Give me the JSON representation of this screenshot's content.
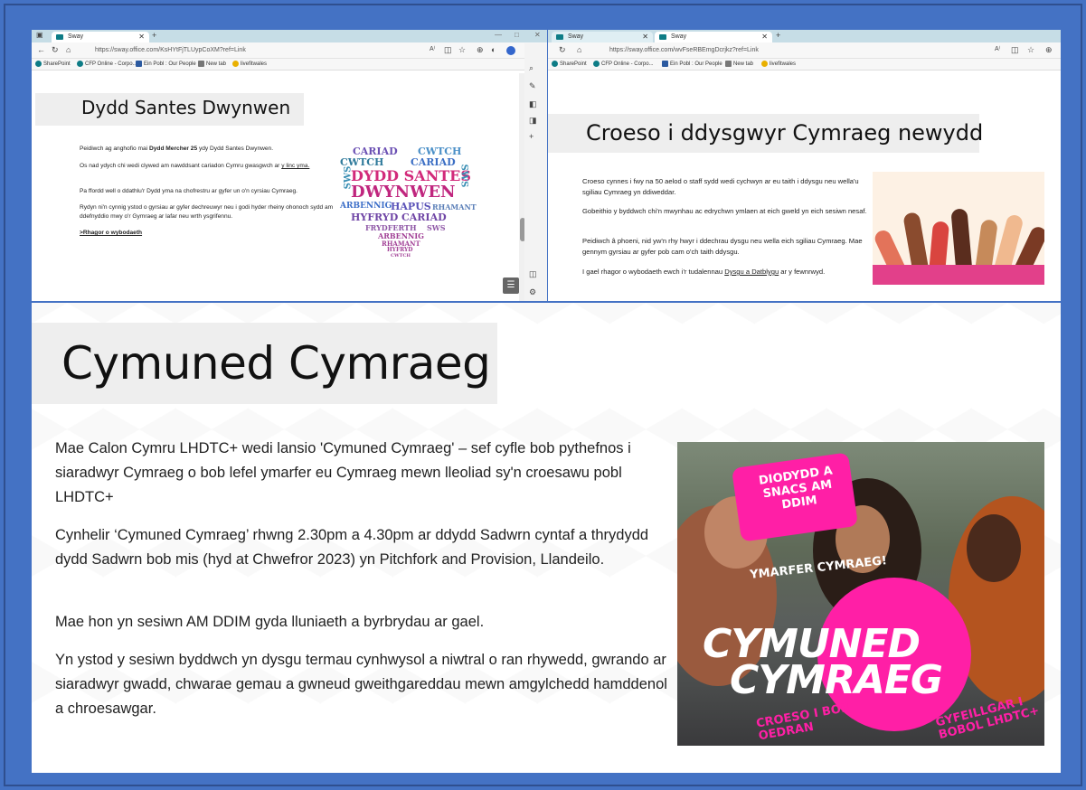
{
  "window1": {
    "tab_label": "Sway",
    "url": "https://sway.office.com/KsHYtFjTLUypCoXM?ref=Link",
    "favorites": [
      "SharePoint",
      "CFP Online - Corpo...",
      "Ein Pobl : Our People",
      "New tab",
      "livefitwales"
    ],
    "title": "Dydd Santes Dwynwen",
    "p1_pre": "Peidiwch ag anghofio mai ",
    "p1_bold": "Dydd Mercher 25",
    "p1_post": " ydy Dydd Santes Dwynwen.",
    "p2_pre": "Os nad ydych chi wedi clywed am nawddsant cariadon Cymru gwasgwch ar ",
    "p2_link": "y linc yma.",
    "p3": "Pa ffordd well o ddathlu'r Dydd yma na chofrestru ar gyfer un o'n cyrsiau Cymraeg.",
    "p4": "Rydyn ni'n cynnig ystod o gyrsiau ar gyfer dechreuwyr neu i godi hyder rheiny ohonoch sydd am ddefnyddio mwy o'r Gymraeg ar lafar neu wrth ysgrifennu.",
    "more_link": ">Rhagor o wybodaeth",
    "word_heart": [
      "CARIAD",
      "CWTCH",
      "CWTCH",
      "CARIAD",
      "SWS",
      "DYDD SANTES",
      "SWS",
      "DWYNWEN",
      "ARBENNIG",
      "HAPUS",
      "RHAMANT",
      "HYFRYD",
      "CARIAD",
      "FRYDFERTH",
      "SWS",
      "ARBENNIG",
      "RHAMANT",
      "HYFRYD",
      "CWTCH"
    ]
  },
  "window2": {
    "tab_label_1": "Sway",
    "tab_label_2": "Sway",
    "url": "https://sway.office.com/wvFseRBEmgDcrjkz?ref=Link",
    "favorites": [
      "SharePoint",
      "CFP Online - Corpo...",
      "Ein Pobl : Our People",
      "New tab",
      "livefitwales"
    ],
    "title": "Croeso i ddysgwyr Cymraeg newydd",
    "p1": "Croeso cynnes i fwy na 50 aelod o staff sydd wedi cychwyn ar eu taith i ddysgu neu wella'u sgiliau Cymraeg yn ddiweddar.",
    "p2": "Gobeithio y byddwch chi'n mwynhau ac edrychwn ymlaen at eich gweld yn eich sesiwn nesaf.",
    "p3": "Peidiwch â phoeni, nid yw'n rhy hwyr i ddechrau dysgu neu wella eich sgiliau Cymraeg. Mae gennym gyrsiau ar gyfer pob cam o'ch taith ddysgu.",
    "p4_pre": "I gael rhagor o wybodaeth ewch i'r tudalennau ",
    "p4_link": "Dysgu a Datblygu",
    "p4_post": " ar y fewnrwyd."
  },
  "main": {
    "title": "Cymuned Cymraeg",
    "p1": "Mae Calon Cymru LHDTC+ wedi lansio 'Cymuned Cymraeg' – sef cyfle bob pythefnos i siaradwyr Cymraeg o bob lefel ymarfer eu Cymraeg mewn lleoliad sy'n croesawu pobl LHDTC+",
    "p2": "Cynhelir ‘Cymuned Cymraeg’ rhwng 2.30pm a 4.30pm ar ddydd Sadwrn cyntaf a thrydydd dydd Sadwrn bob mis (hyd at Chwefror 2023) yn Pitchfork and Provision, Llandeilo.",
    "p3": "Mae hon yn sesiwn AM DDIM gyda lluniaeth a byrbrydau ar gael.",
    "p4": "Yn ystod y sesiwn byddwch yn dysgu termau cynhwysol a niwtral o ran rhywedd, gwrando ar siaradwyr gwadd, chwarae gemau a gwneud gweithgareddau mewn amgylchedd hamddenol a chroesawgar."
  },
  "poster": {
    "tag": "DIODYDD A SNACS AM DDIM",
    "ymarfer": "YMARFER CYMRAEG!",
    "title_line1": "CYMUNED",
    "title_line2": "CYMRAEG",
    "croeso": "CROESO I BOB OEDRAN",
    "gyfeill": "GYFEILLGAR I BOBOL LHDTC+"
  },
  "colors": {
    "background": "#4472c4",
    "accent_pink": "#ff1fa6",
    "title_box": "#eeeeee"
  }
}
